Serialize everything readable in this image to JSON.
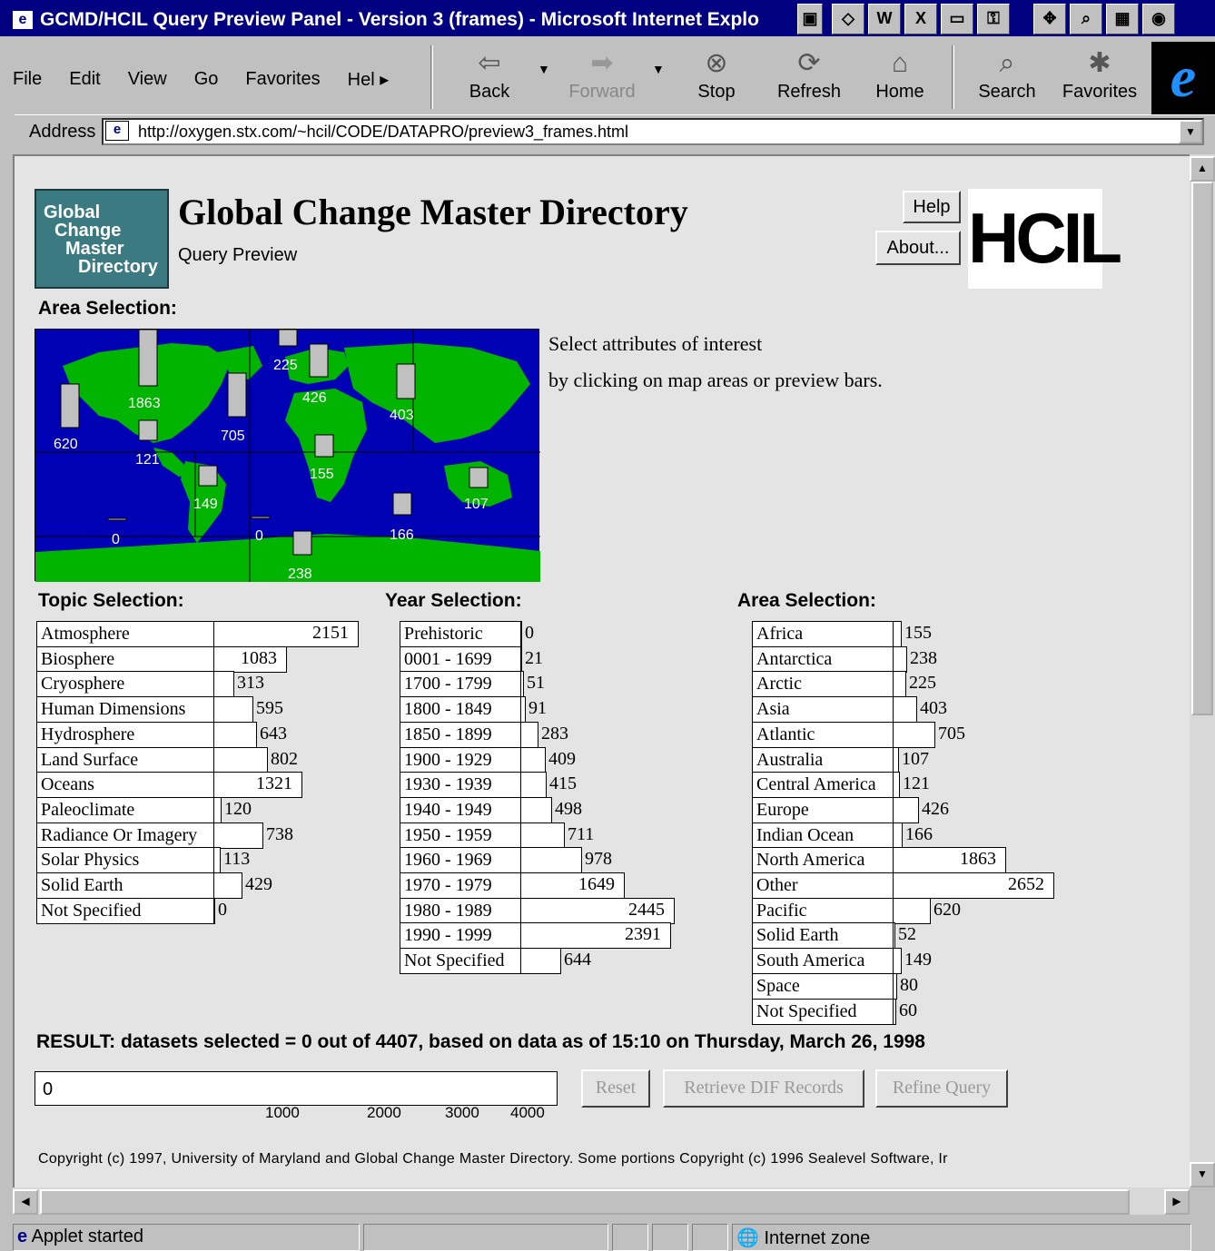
{
  "window": {
    "title": "GCMD/HCIL Query Preview Panel - Version 3 (frames) - Microsoft Internet Explo"
  },
  "menu": [
    "File",
    "Edit",
    "View",
    "Go",
    "Favorites",
    "Hel ▸"
  ],
  "toolbar": {
    "back": "Back",
    "forward": "Forward",
    "stop": "Stop",
    "refresh": "Refresh",
    "home": "Home",
    "search": "Search",
    "favorites": "Favorites"
  },
  "address": {
    "label": "Address",
    "url": "http://oxygen.stx.com/~hcil/CODE/DATAPRO/preview3_frames.html"
  },
  "header": {
    "logo_text": [
      "Global",
      "Change",
      "Master",
      "Directory"
    ],
    "title": "Global Change Master Directory",
    "subtitle": "Query Preview",
    "help": "Help",
    "about": "About...",
    "hcil": "HCIL"
  },
  "area_map": {
    "label": "Area Selection:",
    "counts": [
      {
        "name": "North America",
        "value": "1863"
      },
      {
        "name": "Pacific",
        "value": "620"
      },
      {
        "name": "Central America",
        "value": "121"
      },
      {
        "name": "Atlantic",
        "value": "705"
      },
      {
        "name": "Arctic",
        "value": "225"
      },
      {
        "name": "Europe",
        "value": "426"
      },
      {
        "name": "Asia",
        "value": "403"
      },
      {
        "name": "Africa",
        "value": "155"
      },
      {
        "name": "South America",
        "value": "149"
      },
      {
        "name": "Australia",
        "value": "107"
      },
      {
        "name": "Other",
        "value": "0"
      },
      {
        "name": "Solid Earth",
        "value": "0"
      },
      {
        "name": "Indian Ocean",
        "value": "166"
      },
      {
        "name": "Antarctica",
        "value": "238"
      }
    ]
  },
  "instructions": [
    "Select attributes of interest",
    "by clicking on map areas or preview bars."
  ],
  "topic": {
    "label": "Topic Selection:",
    "rows": [
      {
        "name": "Atmosphere",
        "count": 2151
      },
      {
        "name": "Biosphere",
        "count": 1083
      },
      {
        "name": "Cryosphere",
        "count": 313
      },
      {
        "name": "Human Dimensions",
        "count": 595
      },
      {
        "name": "Hydrosphere",
        "count": 643
      },
      {
        "name": "Land Surface",
        "count": 802
      },
      {
        "name": "Oceans",
        "count": 1321
      },
      {
        "name": "Paleoclimate",
        "count": 120
      },
      {
        "name": "Radiance Or Imagery",
        "count": 738
      },
      {
        "name": "Solar Physics",
        "count": 113
      },
      {
        "name": "Solid Earth",
        "count": 429
      },
      {
        "name": "Not Specified",
        "count": 0
      }
    ]
  },
  "year": {
    "label": "Year Selection:",
    "rows": [
      {
        "name": "Prehistoric",
        "count": 0
      },
      {
        "name": "0001 - 1699",
        "count": 21
      },
      {
        "name": "1700 - 1799",
        "count": 51
      },
      {
        "name": "1800 - 1849",
        "count": 91
      },
      {
        "name": "1850 - 1899",
        "count": 283
      },
      {
        "name": "1900 - 1929",
        "count": 409
      },
      {
        "name": "1930 - 1939",
        "count": 415
      },
      {
        "name": "1940 - 1949",
        "count": 498
      },
      {
        "name": "1950 - 1959",
        "count": 711
      },
      {
        "name": "1960 - 1969",
        "count": 978
      },
      {
        "name": "1970 - 1979",
        "count": 1649
      },
      {
        "name": "1980 - 1989",
        "count": 2445
      },
      {
        "name": "1990 - 1999",
        "count": 2391
      },
      {
        "name": "Not Specified",
        "count": 644
      }
    ]
  },
  "area": {
    "label": "Area Selection:",
    "rows": [
      {
        "name": "Africa",
        "count": 155
      },
      {
        "name": "Antarctica",
        "count": 238
      },
      {
        "name": "Arctic",
        "count": 225
      },
      {
        "name": "Asia",
        "count": 403
      },
      {
        "name": "Atlantic",
        "count": 705
      },
      {
        "name": "Australia",
        "count": 107
      },
      {
        "name": "Central America",
        "count": 121
      },
      {
        "name": "Europe",
        "count": 426
      },
      {
        "name": "Indian Ocean",
        "count": 166
      },
      {
        "name": "North America",
        "count": 1863
      },
      {
        "name": "Other",
        "count": 2652
      },
      {
        "name": "Pacific",
        "count": 620
      },
      {
        "name": "Solid Earth",
        "count": 52
      },
      {
        "name": "South America",
        "count": 149
      },
      {
        "name": "Space",
        "count": 80
      },
      {
        "name": "Not Specified",
        "count": 60
      }
    ]
  },
  "result": {
    "text": "RESULT: datasets selected = 0 out of 4407, based on data as of 15:10 on Thursday, March 26, 1998",
    "value": "0",
    "ticks": [
      "1000",
      "2000",
      "3000",
      "4000"
    ],
    "reset": "Reset",
    "retrieve": "Retrieve DIF Records",
    "refine": "Refine Query"
  },
  "footer": {
    "copyright": "Copyright (c) 1997, University of Maryland and Global Change Master Directory. Some portions Copyright (c) 1996 Sealevel Software, Ir"
  },
  "statusbar": {
    "left": "Applet started",
    "zone": "Internet zone"
  }
}
